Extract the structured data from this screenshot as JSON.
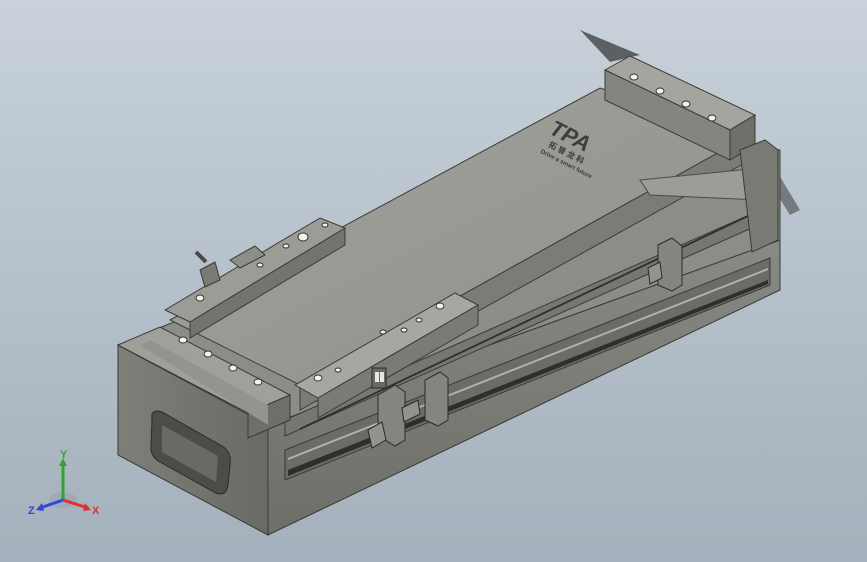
{
  "viewport": {
    "background_top": "#c9d2da",
    "background_bottom": "#a4b0bb"
  },
  "model": {
    "body_color": "#8a8a84",
    "top_color": "#9a9a94",
    "dark_color": "#5c5c57",
    "logo": {
      "brand": "TPA",
      "cn_text": "拓 普 龙 科",
      "en_text": "Drive a smart future"
    }
  },
  "triad": {
    "x_label": "X",
    "y_label": "Y",
    "z_label": "Z",
    "x_color": "#e03030",
    "y_color": "#2fa52f",
    "z_color": "#2f46d8"
  }
}
